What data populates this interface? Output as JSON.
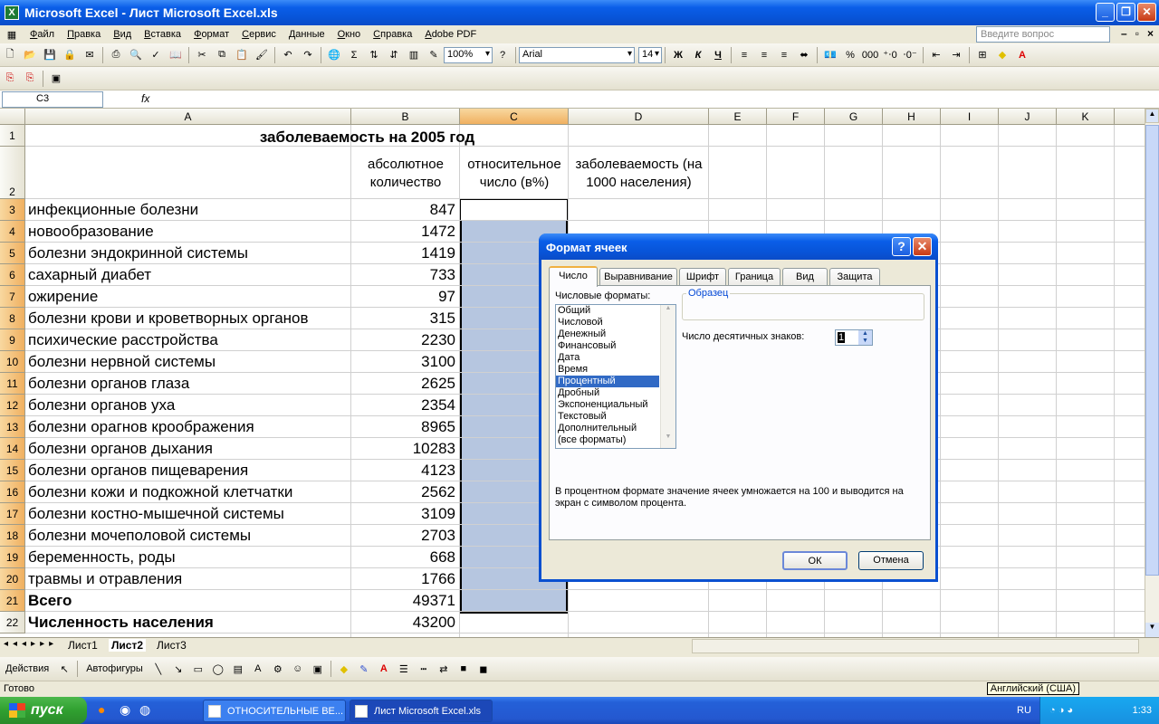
{
  "window": {
    "title": "Microsoft Excel - Лист Microsoft Excel.xls"
  },
  "menu": [
    "Файл",
    "Правка",
    "Вид",
    "Вставка",
    "Формат",
    "Сервис",
    "Данные",
    "Окно",
    "Справка",
    "Adobe PDF"
  ],
  "help_placeholder": "Введите вопрос",
  "toolbar": {
    "zoom": "100%",
    "font": "Arial",
    "size": "14"
  },
  "formula": {
    "namebox": "C3",
    "fx": "fx",
    "content": ""
  },
  "columns": [
    "A",
    "B",
    "C",
    "D",
    "E",
    "F",
    "G",
    "H",
    "I",
    "J",
    "K"
  ],
  "rows": [
    "1",
    "2",
    "3",
    "4",
    "5",
    "6",
    "7",
    "8",
    "9",
    "10",
    "11",
    "12",
    "13",
    "14",
    "15",
    "16",
    "17",
    "18",
    "19",
    "20",
    "21",
    "22"
  ],
  "sheet": {
    "title": "заболеваемость на 2005 год",
    "header_b": "абсолютное количество",
    "header_c": "относительное число (в%)",
    "header_d": "заболеваемость (на 1000 населения)",
    "data": [
      {
        "name": "инфекционные болезни",
        "value": "847"
      },
      {
        "name": "новообразование",
        "value": "1472"
      },
      {
        "name": "болезни эндокринной системы",
        "value": "1419"
      },
      {
        "name": "сахарный диабет",
        "value": "733"
      },
      {
        "name": "ожирение",
        "value": "97"
      },
      {
        "name": "болезни крови и кроветворных органов",
        "value": "315"
      },
      {
        "name": "психические расстройства",
        "value": "2230"
      },
      {
        "name": "болезни нервной системы",
        "value": "3100"
      },
      {
        "name": "болезни органов глаза",
        "value": "2625"
      },
      {
        "name": "болезни органов уха",
        "value": "2354"
      },
      {
        "name": "болезни орагнов кроображения",
        "value": "8965"
      },
      {
        "name": "болезни органов дыхания",
        "value": "10283"
      },
      {
        "name": "болезни органов пищеварения",
        "value": "4123"
      },
      {
        "name": "болезни кожи и подкожной клетчатки",
        "value": "2562"
      },
      {
        "name": "болезни костно-мышечной системы",
        "value": "3109"
      },
      {
        "name": "болезни мочеполовой системы",
        "value": "2703"
      },
      {
        "name": "беременность, роды",
        "value": "668"
      },
      {
        "name": "травмы и отравления",
        "value": "1766"
      }
    ],
    "total_label": "Всего",
    "total_value": "49371",
    "pop_label": "Численность населения",
    "pop_value": "43200"
  },
  "sheet_tabs": [
    "Лист1",
    "Лист2",
    "Лист3"
  ],
  "drawbar": {
    "actions": "Действия",
    "autoshapes": "Автофигуры"
  },
  "status": "Готово",
  "tooltip": "Английский (США)",
  "dialog": {
    "title": "Формат ячеек",
    "tabs": [
      "Число",
      "Выравнивание",
      "Шрифт",
      "Граница",
      "Вид",
      "Защита"
    ],
    "formats_label": "Числовые форматы:",
    "formats": [
      "Общий",
      "Числовой",
      "Денежный",
      "Финансовый",
      "Дата",
      "Время",
      "Процентный",
      "Дробный",
      "Экспоненциальный",
      "Текстовый",
      "Дополнительный",
      "(все форматы)"
    ],
    "selected_format": "Процентный",
    "sample_label": "Образец",
    "decimals_label": "Число десятичных знаков:",
    "decimals_value": "1",
    "description": "В процентном формате значение ячеек умножается на 100 и выводится на экран с символом процента.",
    "ok": "ОК",
    "cancel": "Отмена"
  },
  "taskbar": {
    "start": "пуск",
    "items": [
      "ОТНОСИТЕЛЬНЫЕ ВЕ...",
      "Лист Microsoft Excel.xls"
    ],
    "lang": "RU",
    "time": "1:33"
  }
}
